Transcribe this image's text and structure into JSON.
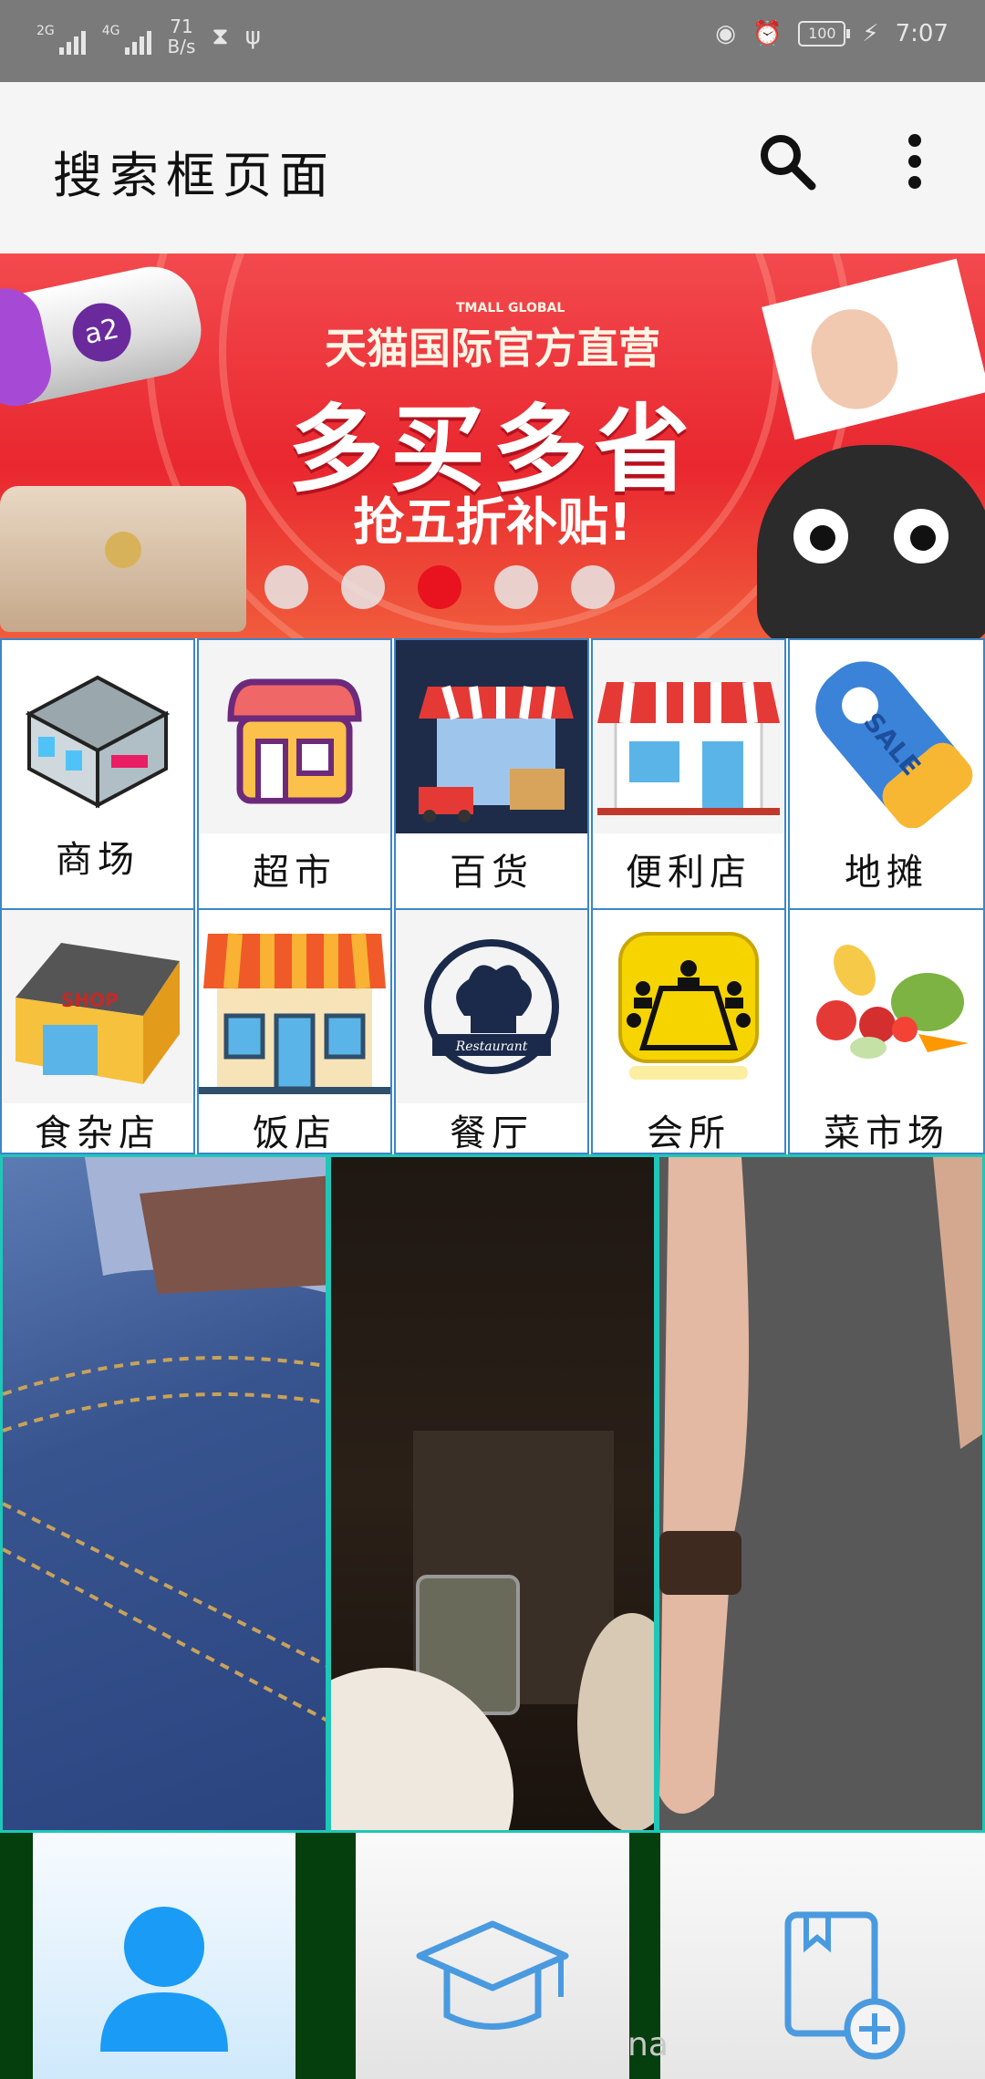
{
  "status_bar": {
    "signal1": "2G",
    "signal2": "4G",
    "net_speed_value": "71",
    "net_speed_unit": "B/s",
    "battery": "100",
    "time": "7:07"
  },
  "app_bar": {
    "title": "搜索框页面"
  },
  "banner": {
    "subtitle": "天猫国际官方直营",
    "brand_small": "TMALL GLOBAL",
    "headline": "多买多省",
    "tagline": "抢五折补贴!",
    "can_logo": "a2",
    "active_dot_index": 2,
    "dot_count": 5
  },
  "categories": [
    {
      "label": "商场",
      "icon": "mall-building-icon"
    },
    {
      "label": "超市",
      "icon": "supermarket-store-icon"
    },
    {
      "label": "百货",
      "icon": "department-store-icon"
    },
    {
      "label": "便利店",
      "icon": "convenience-shop-icon"
    },
    {
      "label": "地摊",
      "icon": "sale-tag-icon"
    },
    {
      "label": "食杂店",
      "icon": "grocery-shop-icon"
    },
    {
      "label": "饭店",
      "icon": "restaurant-awning-icon"
    },
    {
      "label": "餐厅",
      "icon": "chef-hat-icon"
    },
    {
      "label": "会所",
      "icon": "meeting-room-icon"
    },
    {
      "label": "菜市场",
      "icon": "vegetables-icon"
    }
  ],
  "photos": [
    "jeans-photo",
    "dark-bag-photo",
    "arm-photo"
  ],
  "tab_bar": {
    "tabs": [
      {
        "icon": "person-icon",
        "color": "#1a9bf5"
      },
      {
        "icon": "graduation-cap-icon",
        "color": "#4a9ae0"
      },
      {
        "icon": "add-book-icon",
        "color": "#4a9ae0"
      }
    ],
    "hint_text": "na"
  }
}
